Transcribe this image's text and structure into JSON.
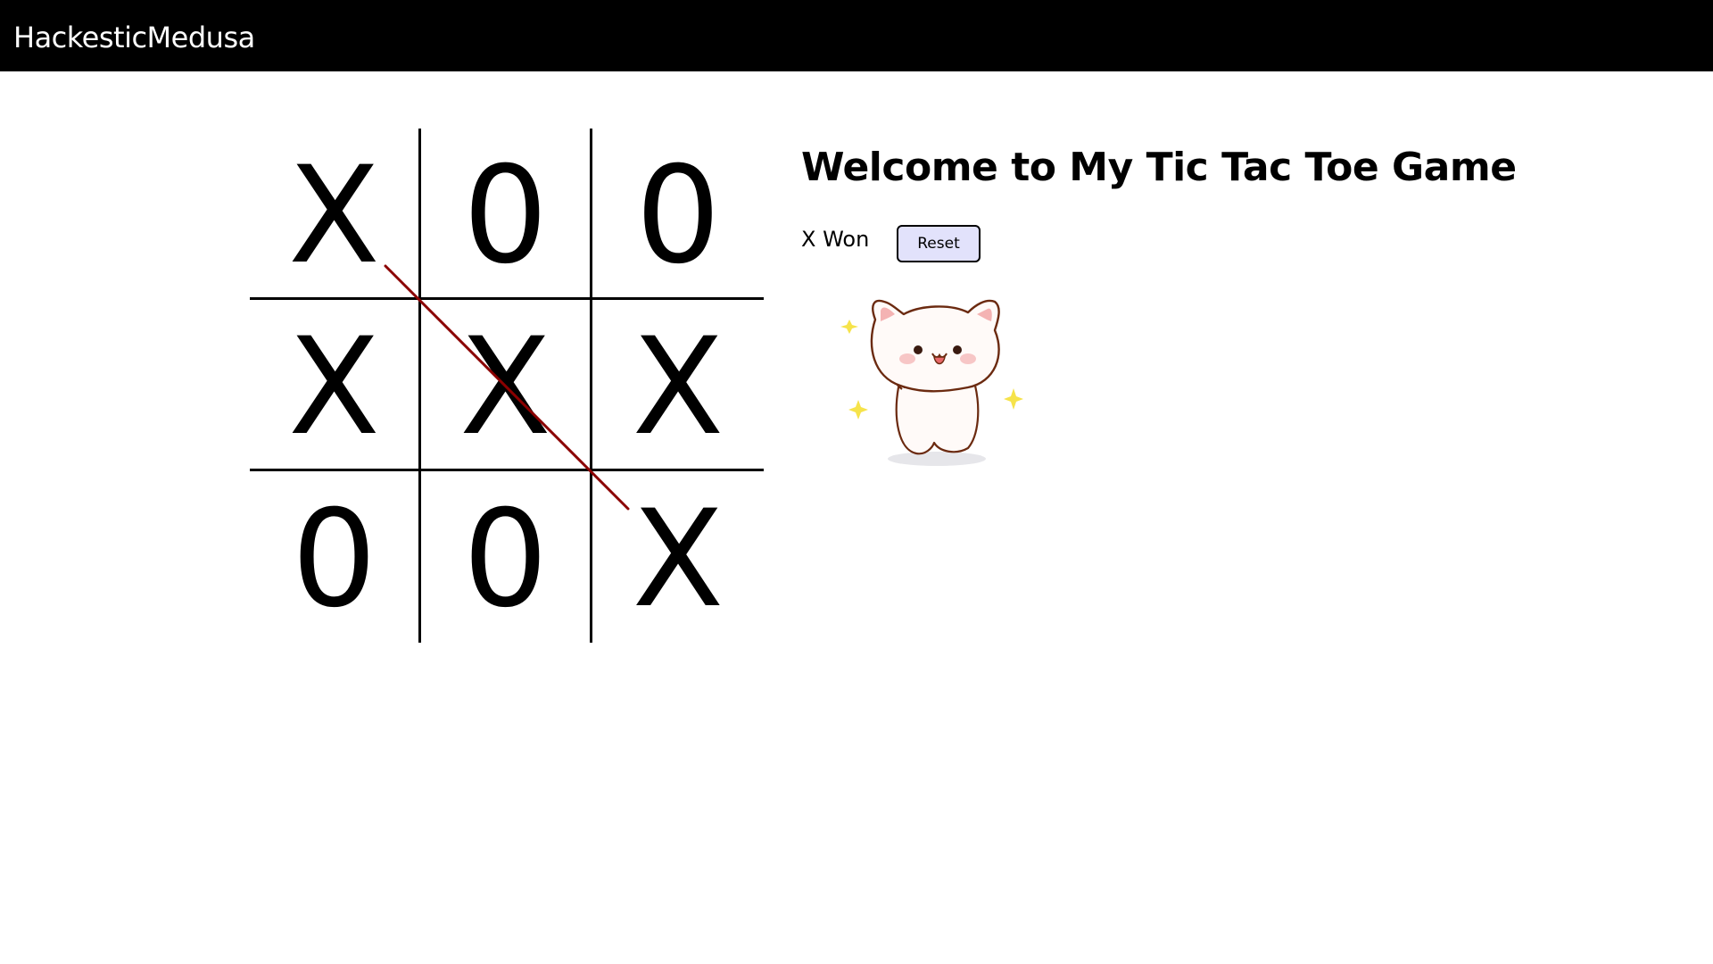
{
  "navbar": {
    "brand": "HackesticMedusa"
  },
  "game": {
    "title": "Welcome to My Tic Tac Toe Game",
    "status": "X Won",
    "reset_label": "Reset",
    "board": [
      "X",
      "0",
      "0",
      "X",
      "X",
      "X",
      "0",
      "0",
      "X"
    ],
    "winner": "X",
    "winning_line": "main diagonal",
    "win_line_color": "#8b0000"
  },
  "celebration": {
    "image": "happy-cat-sticker-icon"
  }
}
